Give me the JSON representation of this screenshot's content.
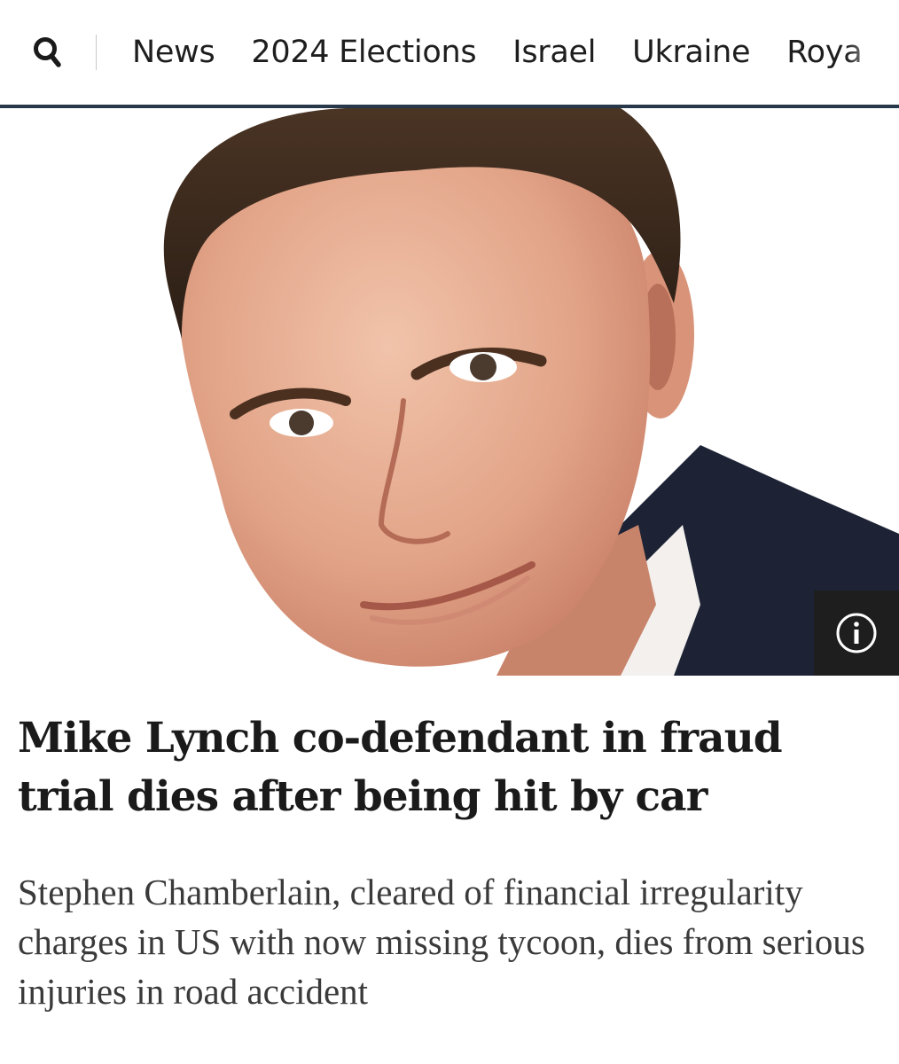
{
  "nav": {
    "search_icon": "search-icon",
    "items": [
      {
        "label": "News"
      },
      {
        "label": "2024 Elections"
      },
      {
        "label": "Israel"
      },
      {
        "label": "Ukraine"
      },
      {
        "label": "Roya"
      }
    ],
    "underline_color": "#27384a"
  },
  "hero": {
    "info_icon": "info-icon"
  },
  "article": {
    "headline": "Mike Lynch co-defendant in fraud trial dies after being hit by car",
    "standfirst": "Stephen Chamberlain, cleared of financial irregularity charges in US with now missing tycoon, dies from serious injuries in road accident"
  }
}
